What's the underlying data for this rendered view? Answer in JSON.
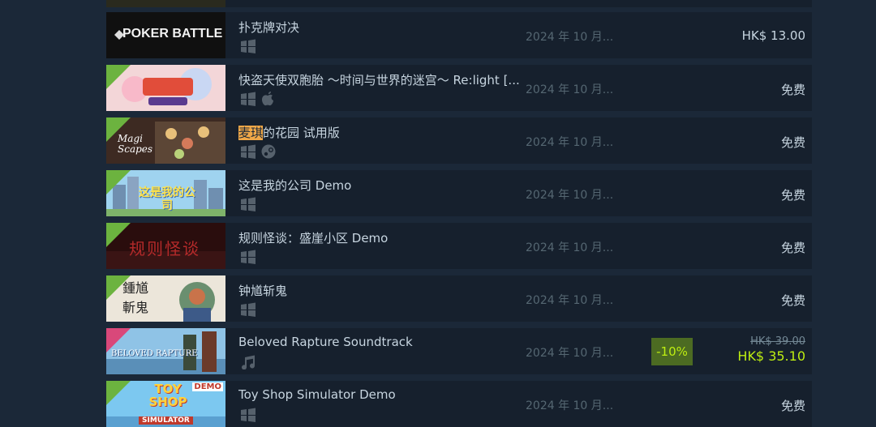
{
  "rows": [
    {
      "title": "",
      "date": "",
      "price": ""
    },
    {
      "title": "扑克牌对决",
      "thumb_text": "POKER BATTLE",
      "date": "2024 年 10 月...",
      "price": "HK$ 13.00",
      "platforms": [
        "windows-icon"
      ]
    },
    {
      "title": "快盗天使双胞胎 ～时间与世界的迷宫～ Re:light [...",
      "date": "2024 年 10 月...",
      "price": "免费",
      "platforms": [
        "windows-icon",
        "apple-icon"
      ]
    },
    {
      "title_highlight": "麦琪",
      "title_rest": "的花园 试用版",
      "thumb_text": "Magi Scapes",
      "date": "2024 年 10 月...",
      "price": "免费",
      "platforms": [
        "windows-icon",
        "steam-icon"
      ]
    },
    {
      "title": "这是我的公司 Demo",
      "thumb_text": "这是我的公司",
      "date": "2024 年 10 月...",
      "price": "免费",
      "platforms": [
        "windows-icon"
      ]
    },
    {
      "title": "规则怪谈：盛崖小区 Demo",
      "thumb_text": "规则怪谈",
      "date": "2024 年 10 月...",
      "price": "免费",
      "platforms": [
        "windows-icon"
      ]
    },
    {
      "title": "钟馗斩鬼",
      "thumb_text": "鍾馗斬鬼",
      "date": "2024 年 10 月...",
      "price": "免费",
      "platforms": [
        "windows-icon"
      ]
    },
    {
      "title": "Beloved Rapture Soundtrack",
      "thumb_text": "BELOVED RAPTURE",
      "date": "2024 年 10 月...",
      "discount": "-10%",
      "original_price": "HK$ 39.00",
      "final_price": "HK$ 35.10",
      "platforms": [
        "music-icon"
      ]
    },
    {
      "title": "Toy Shop Simulator Demo",
      "thumb_text": "TOY SHOP",
      "thumb_sub": "SIMULATOR",
      "thumb_corner": "DEMO",
      "date": "2024 年 10 月...",
      "price": "免费",
      "platforms": [
        "windows-icon"
      ]
    }
  ],
  "colors": {
    "background": "#1b2838",
    "row": "#16202d",
    "discount_bg": "#4c6b22",
    "discount_text": "#beee11",
    "highlight": "#f0a848"
  }
}
